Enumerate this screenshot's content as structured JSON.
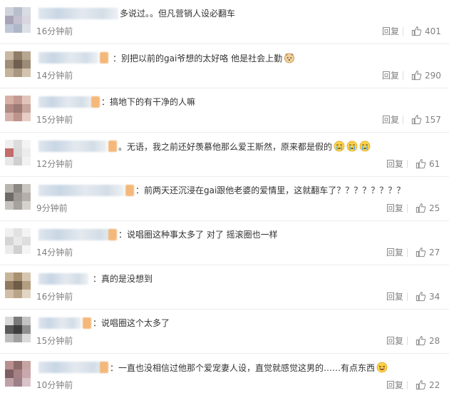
{
  "comments": [
    {
      "text": "多说过。。但凡营销人设必翻车",
      "time": "16分钟前",
      "reply": "回复",
      "likes": "401"
    },
    {
      "text": "：别把以前的gai爷想的太好咯 他是社会上勤",
      "time": "14分钟前",
      "reply": "回复",
      "likes": "290"
    },
    {
      "text": "：搞地下的有干净的人嘛",
      "time": "15分钟前",
      "reply": "回复",
      "likes": "157"
    },
    {
      "text": "。无语，我之前还好羡慕他那么爱王斯然，原来都是假的",
      "time": "12分钟前",
      "reply": "回复",
      "likes": "61"
    },
    {
      "text": "：前两天还沉浸在gai跟他老婆的爱情里，这就翻车了？？？？？？？？",
      "time": "9分钟前",
      "reply": "回复",
      "likes": "25"
    },
    {
      "text": "：说唱圈这种事太多了 对了 摇滚圈也一样",
      "time": "14分钟前",
      "reply": "回复",
      "likes": "27"
    },
    {
      "text": "：真的是没想到",
      "time": "16分钟前",
      "reply": "回复",
      "likes": "34"
    },
    {
      "text": "：说唱圈这个太多了",
      "time": "15分钟前",
      "reply": "回复",
      "likes": "28"
    },
    {
      "text": "：一直也没相信过他那个爱宠妻人设，直觉就感觉这男的……有点东西",
      "time": "10分钟前",
      "reply": "回复",
      "likes": "22"
    }
  ]
}
